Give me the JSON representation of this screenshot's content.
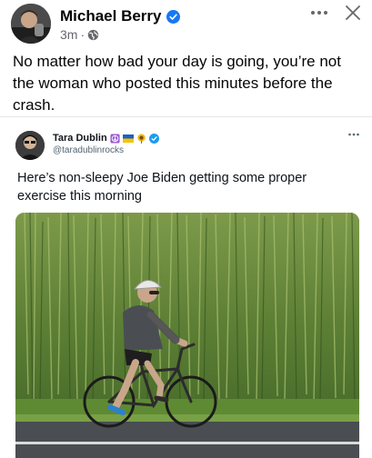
{
  "post": {
    "author": "Michael Berry",
    "time": "3m",
    "separator": "·",
    "text": "No matter how bad your day is going, you’re not the woman who posted this minutes before the crash."
  },
  "tweet": {
    "author": "Tara Dublin",
    "handle": "@taradublinrocks",
    "text": "Here’s non-sleepy Joe Biden getting some proper exercise this morning"
  },
  "icons": {
    "verified": "verified-badge-icon",
    "audience": "globe-icon",
    "more": "more-options-icon",
    "close": "close-icon"
  },
  "colors": {
    "verified_blue": "#1877f2",
    "twitter_blue": "#1d9bf0",
    "text_primary": "#050505",
    "text_secondary": "#65676b"
  }
}
